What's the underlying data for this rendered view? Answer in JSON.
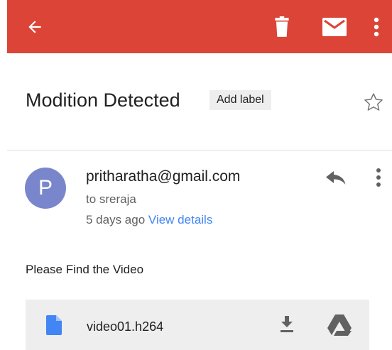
{
  "colors": {
    "app_bar": "#db4437",
    "avatar": "#7986cb",
    "link": "#4285f4",
    "file_icon": "#4285f4"
  },
  "toolbar": {
    "back_icon": "arrow-back-icon",
    "delete_icon": "trash-icon",
    "mark_unread_icon": "mail-icon",
    "more_icon": "more-vert-icon"
  },
  "message": {
    "subject": "Modition Detected",
    "add_label": "Add label",
    "star_icon": "star-outline-icon",
    "avatar_letter": "P",
    "sender": "pritharatha@gmail.com",
    "recipient": "to sreraja",
    "time": "5 days ago",
    "view_details": "View details",
    "reply_icon": "reply-icon",
    "body": "Please Find the Video"
  },
  "attachment": {
    "file_icon": "file-icon",
    "file_name": "video01.h264",
    "download_icon": "download-icon",
    "drive_icon": "drive-icon"
  }
}
